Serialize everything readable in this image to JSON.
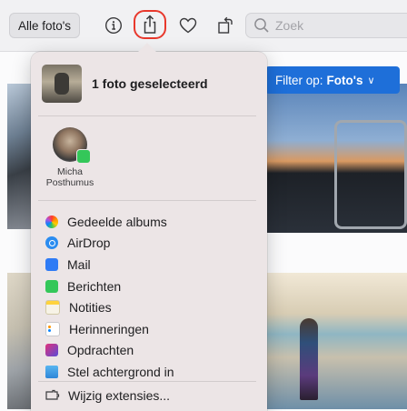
{
  "toolbar": {
    "all_photos_label": "Alle foto's",
    "search_placeholder": "Zoek"
  },
  "grid": {
    "filter_label": "Filter op:",
    "filter_value": "Foto's",
    "filter_chevron": "∨"
  },
  "share_menu": {
    "selection_title": "1 foto geselecteerd",
    "contact": {
      "first_name": "Micha",
      "last_name": "Posthumus"
    },
    "items": [
      {
        "label": "Gedeelde albums",
        "icon": "photos-icon"
      },
      {
        "label": "AirDrop",
        "icon": "airdrop-icon"
      },
      {
        "label": "Mail",
        "icon": "mail-icon"
      },
      {
        "label": "Berichten",
        "icon": "messages-icon"
      },
      {
        "label": "Notities",
        "icon": "notes-icon"
      },
      {
        "label": "Herinneringen",
        "icon": "reminders-icon"
      },
      {
        "label": "Opdrachten",
        "icon": "shortcuts-icon"
      },
      {
        "label": "Stel achtergrond in",
        "icon": "wallpaper-icon"
      }
    ],
    "extensions_label": "Wijzig extensies..."
  },
  "colors": {
    "highlight_ring": "#e8382c",
    "filter_blue": "#1e6fd9"
  }
}
